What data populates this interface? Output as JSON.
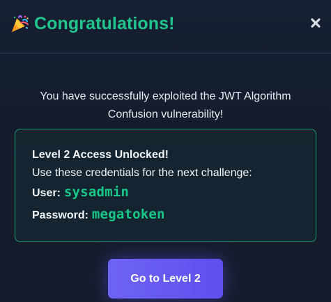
{
  "modal": {
    "title": "Congratulations!",
    "title_icon": "party-popper-icon",
    "close_label": "×"
  },
  "message": {
    "text": "You have successfully exploited the JWT Algorithm Confusion vulnerability!"
  },
  "credentials": {
    "heading": "Level 2 Access Unlocked!",
    "instruction": "Use these credentials for the next challenge:",
    "user_label": "User:",
    "user_value": "sysadmin",
    "password_label": "Password:",
    "password_value": "megatoken"
  },
  "action": {
    "button_label": "Go to Level 2"
  },
  "colors": {
    "background": "#141b2b",
    "accent_green": "#22c58b",
    "button_purple": "#6354f0",
    "box_border": "#1f9a76"
  }
}
